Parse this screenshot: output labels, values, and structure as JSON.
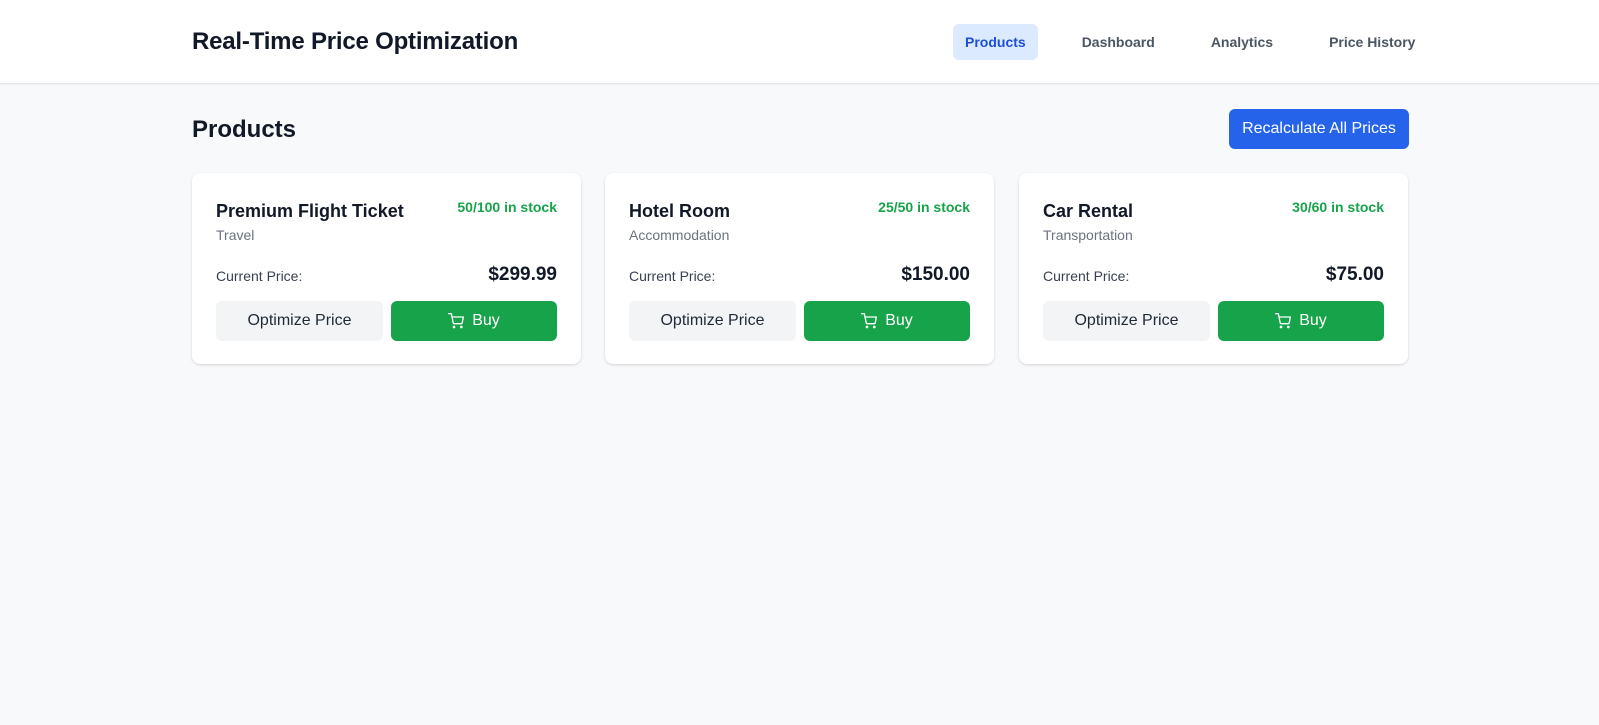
{
  "header": {
    "title": "Real-Time Price Optimization",
    "nav": [
      {
        "label": "Products",
        "active": true
      },
      {
        "label": "Dashboard",
        "active": false
      },
      {
        "label": "Analytics",
        "active": false
      },
      {
        "label": "Price History",
        "active": false
      }
    ]
  },
  "main": {
    "title": "Products",
    "recalculate_label": "Recalculate All Prices",
    "products": [
      {
        "name": "Premium Flight Ticket",
        "category": "Travel",
        "stock": "50/100 in stock",
        "price_label": "Current Price:",
        "price": "$299.99",
        "optimize_label": "Optimize Price",
        "buy_label": "Buy",
        "buy_icon": "shopping-cart-icon"
      },
      {
        "name": "Hotel Room",
        "category": "Accommodation",
        "stock": "25/50 in stock",
        "price_label": "Current Price:",
        "price": "$150.00",
        "optimize_label": "Optimize Price",
        "buy_label": "Buy",
        "buy_icon": "shopping-cart-icon"
      },
      {
        "name": "Car Rental",
        "category": "Transportation",
        "stock": "30/60 in stock",
        "price_label": "Current Price:",
        "price": "$75.00",
        "optimize_label": "Optimize Price",
        "buy_label": "Buy",
        "buy_icon": "shopping-cart-icon"
      }
    ]
  },
  "colors": {
    "primary": "#2563eb",
    "success": "#16a34a",
    "nav_active_bg": "#dbeafe",
    "nav_active_text": "#1d4ed8",
    "page_bg": "#f8f9fb"
  }
}
